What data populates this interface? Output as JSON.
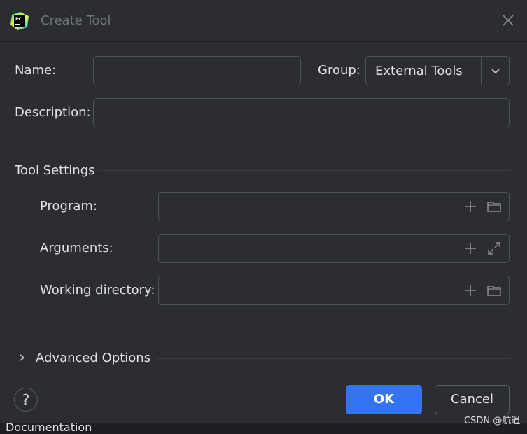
{
  "dialog": {
    "title": "Create Tool"
  },
  "form": {
    "name_label": "Name:",
    "name_value": "",
    "group_label": "Group:",
    "group_value": "External Tools",
    "description_label": "Description:",
    "description_value": ""
  },
  "tool_settings": {
    "section_label": "Tool Settings",
    "program_label": "Program:",
    "program_value": "",
    "arguments_label": "Arguments:",
    "arguments_value": "",
    "working_dir_label": "Working directory:",
    "working_dir_value": ""
  },
  "advanced": {
    "label": "Advanced Options",
    "expanded": false
  },
  "footer": {
    "help_label": "?",
    "ok_label": "OK",
    "cancel_label": "Cancel"
  },
  "background": {
    "partial_text": "Documentation",
    "watermark": "CSDN @航逍"
  },
  "icons": {
    "app": "pycharm-logo-icon",
    "close": "close-icon",
    "dropdown": "chevron-down-icon",
    "insert_macro": "plus-icon",
    "browse": "folder-icon",
    "expand": "expand-icon",
    "collapsed": "chevron-right-icon"
  },
  "colors": {
    "accent": "#3574f0",
    "dialog_bg": "#2b2d30",
    "text": "#dfe1e5",
    "border": "#4e5157"
  }
}
